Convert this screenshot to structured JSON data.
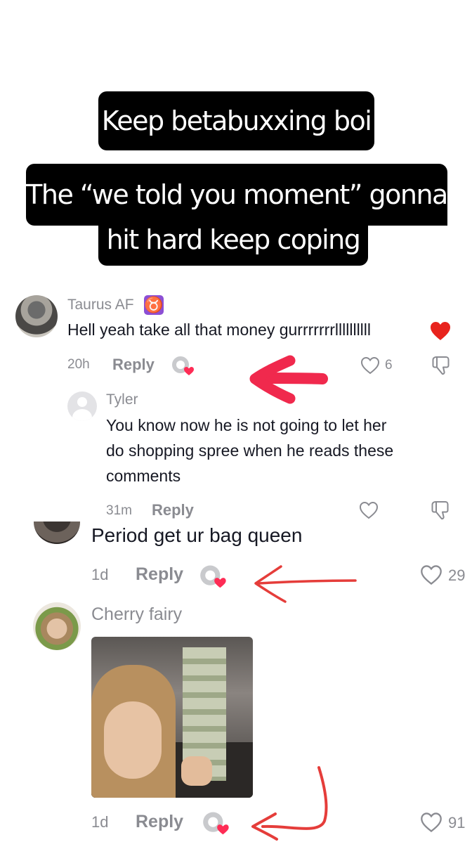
{
  "captions": {
    "line1": "Keep betabuxxing boi",
    "line2a": "The “we told you moment” gonna",
    "line2b": "hit hard keep coping"
  },
  "comments": [
    {
      "username": "Taurus AF",
      "badge": "taurus-sign-icon",
      "text": "Hell yeah take all that money gurrrrrrrllllllllll",
      "emoji": "red-heart-icon",
      "time": "20h",
      "reply_label": "Reply",
      "likes": "6"
    },
    {
      "username": "Tyler",
      "text_lines": [
        "You know now he is not going to let her",
        "do shopping spree when he reads these",
        "comments"
      ],
      "time": "31m",
      "reply_label": "Reply",
      "likes": ""
    },
    {
      "username": "",
      "text": "Period get ur bag queen",
      "time": "1d",
      "reply_label": "Reply",
      "likes": "29"
    },
    {
      "username": "Cherry fairy",
      "image": "photo of woman holding a fan of dollar bills",
      "time": "1d",
      "reply_label": "Reply",
      "likes": "91"
    }
  ],
  "colors": {
    "annotation_arrow": "#f0294d",
    "meta_gray": "#8a8b91",
    "heart_red": "#fe2c55"
  }
}
